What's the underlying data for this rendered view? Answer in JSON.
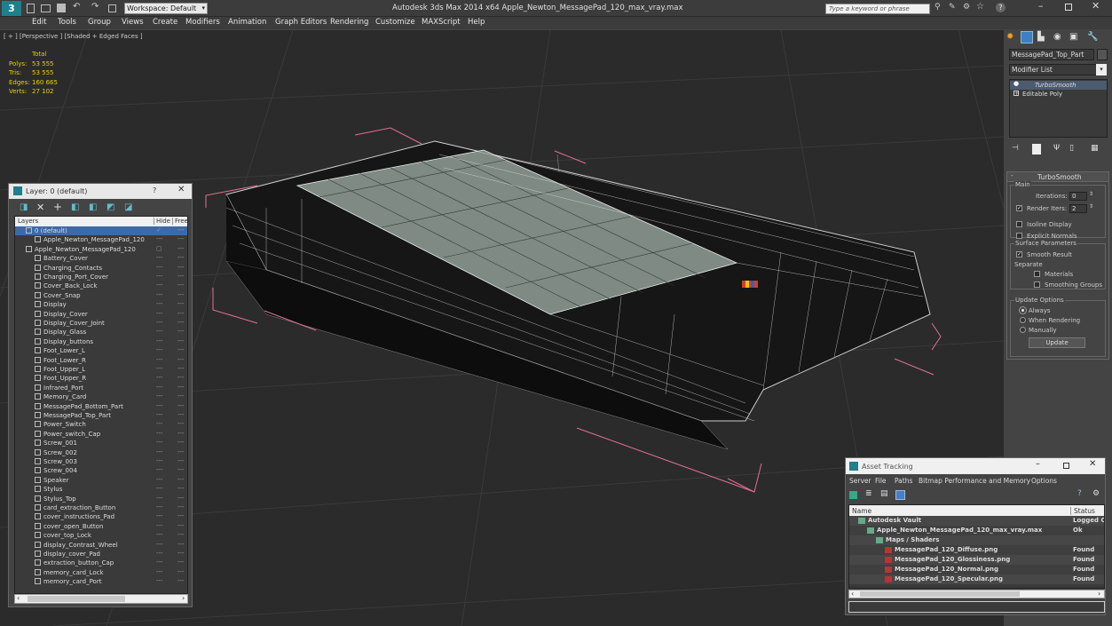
{
  "titlebar": {
    "workspace": "Workspace: Default",
    "title": "Autodesk 3ds Max  2014 x64     Apple_Newton_MessagePad_120_max_vray.max",
    "search_placeholder": "Type a keyword or phrase"
  },
  "menu": [
    "Edit",
    "Tools",
    "Group",
    "Views",
    "Create",
    "Modifiers",
    "Animation",
    "Graph Editors",
    "Rendering",
    "Customize",
    "MAXScript",
    "Help"
  ],
  "viewport": {
    "label": "[ + ] [Perspective ] [Shaded + Edged Faces ]",
    "stats_header": "Total",
    "stats": [
      {
        "k": "Polys:",
        "v": "53 555"
      },
      {
        "k": "Tris:",
        "v": "53 555"
      },
      {
        "k": "Edges:",
        "v": "160 665"
      },
      {
        "k": "Verts:",
        "v": "27 102"
      }
    ]
  },
  "layers": {
    "title": "Layer: 0 (default)",
    "help": "?",
    "col_layers": "Layers",
    "col_hide": "Hide",
    "col_freeze": "Free",
    "items": [
      "0 (default)",
      "Apple_Newton_MessagePad_120",
      "Apple_Newton_MessagePad_120",
      "Battery_Cover",
      "Charging_Contacts",
      "Charging_Port_Cover",
      "Cover_Back_Lock",
      "Cover_Snap",
      "Display",
      "Display_Cover",
      "Display_Cover_Joint",
      "Display_Glass",
      "Display_buttons",
      "Foot_Lower_L",
      "Foot_Lower_R",
      "Foot_Upper_L",
      "Foot_Upper_R",
      "Infrared_Port",
      "Memory_Card",
      "MessagePad_Bottom_Part",
      "MessagePad_Top_Part",
      "Power_Switch",
      "Power_switch_Cap",
      "Screw_001",
      "Screw_002",
      "Screw_003",
      "Screw_004",
      "Speaker",
      "Stylus",
      "Stylus_Top",
      "card_extraction_Button",
      "cover_instructions_Pad",
      "cover_open_Button",
      "cover_top_Lock",
      "display_Contrast_Wheel",
      "display_cover_Pad",
      "extraction_button_Cap",
      "memory_card_Lock",
      "memory_card_Port"
    ]
  },
  "command_panel": {
    "object_name": "MessagePad_Top_Part",
    "modifier_list": "Modifier List",
    "stack": [
      "TurboSmooth",
      "Editable Poly"
    ],
    "rollout": "TurboSmooth",
    "main": "Main",
    "iterations_label": "Iterations:",
    "iterations": "0",
    "render_iters_label": "Render Iters:",
    "render_iters": "2",
    "isoline": "Isoline Display",
    "explicit": "Explicit Normals",
    "surface": "Surface Parameters",
    "smooth_result": "Smooth Result",
    "separate": "Separate",
    "materials": "Materials",
    "smoothing_groups": "Smoothing Groups",
    "update_options": "Update Options",
    "always": "Always",
    "when_rendering": "When Rendering",
    "manually": "Manually",
    "update": "Update"
  },
  "asset": {
    "title": "Asset Tracking",
    "menu": [
      "Server",
      "File",
      "Paths",
      "Bitmap Performance and Memory",
      "Options"
    ],
    "col_name": "Name",
    "col_status": "Status",
    "rows": [
      {
        "name": "Autodesk Vault",
        "status": "Logged O"
      },
      {
        "name": "Apple_Newton_MessagePad_120_max_vray.max",
        "status": "Ok"
      },
      {
        "name": "Maps / Shaders",
        "status": ""
      },
      {
        "name": "MessagePad_120_Diffuse.png",
        "status": "Found"
      },
      {
        "name": "MessagePad_120_Glossiness.png",
        "status": "Found"
      },
      {
        "name": "MessagePad_120_Normal.png",
        "status": "Found"
      },
      {
        "name": "MessagePad_120_Specular.png",
        "status": "Found"
      }
    ]
  }
}
